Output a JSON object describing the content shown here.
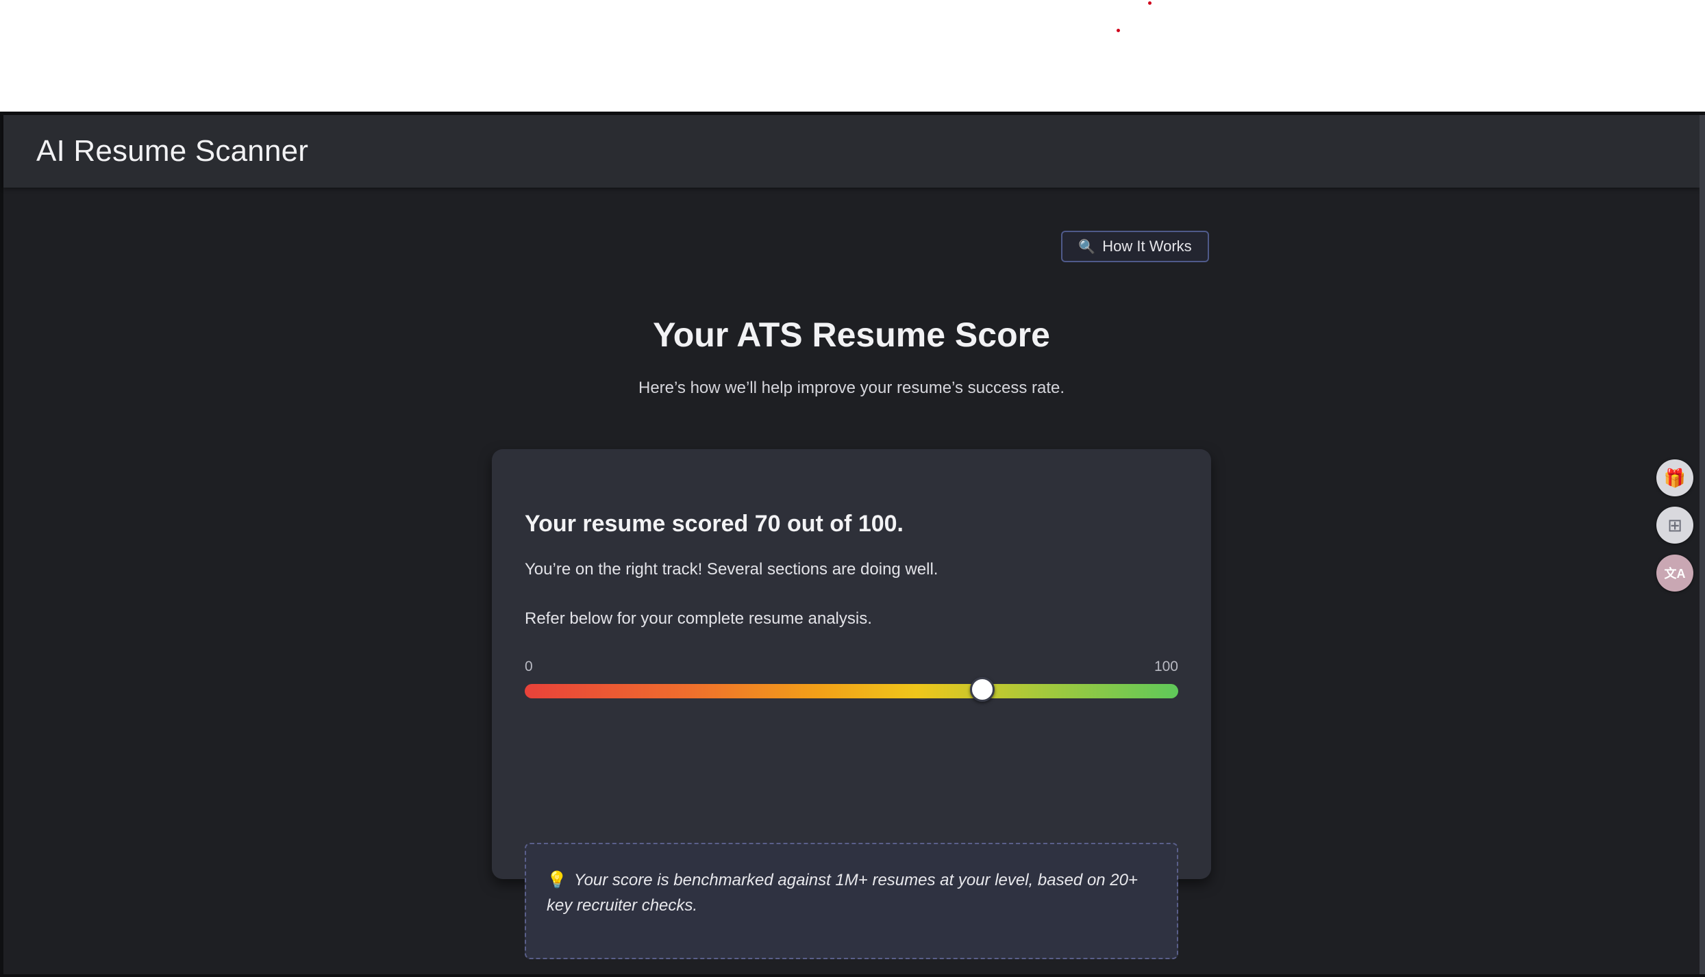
{
  "app": {
    "title": "AI Resume Scanner"
  },
  "toolbar": {
    "how_it_works_icon": "🔍",
    "how_it_works_label": "How It Works"
  },
  "hero": {
    "title": "Your ATS Resume Score",
    "subtitle": "Here’s how we’ll help improve your resume’s success rate."
  },
  "score_card": {
    "headline": "Your resume scored 70 out of 100.",
    "message": "You’re on the right track! Several sections are doing well.",
    "refer": "Refer below for your complete resume analysis.",
    "range_min": "0",
    "range_max": "100",
    "score_value": 70,
    "score_max": 100,
    "tip_icon": "💡",
    "tip_text": "Your score is benchmarked against 1M+ resumes at your level, based on 20+ key recruiter checks."
  },
  "side_tools": [
    {
      "name": "gift-icon",
      "glyph": "🎁"
    },
    {
      "name": "add-apps-icon",
      "glyph": "⊞"
    },
    {
      "name": "translate-icon",
      "glyph": "文A"
    }
  ],
  "colors": {
    "background": "#1e1f23",
    "header": "#2a2c31",
    "card": "#2e3039",
    "accent_border": "#4f5a8a",
    "bar_low": "#e8423a",
    "bar_mid": "#efc61b",
    "bar_high": "#5fc85a"
  }
}
